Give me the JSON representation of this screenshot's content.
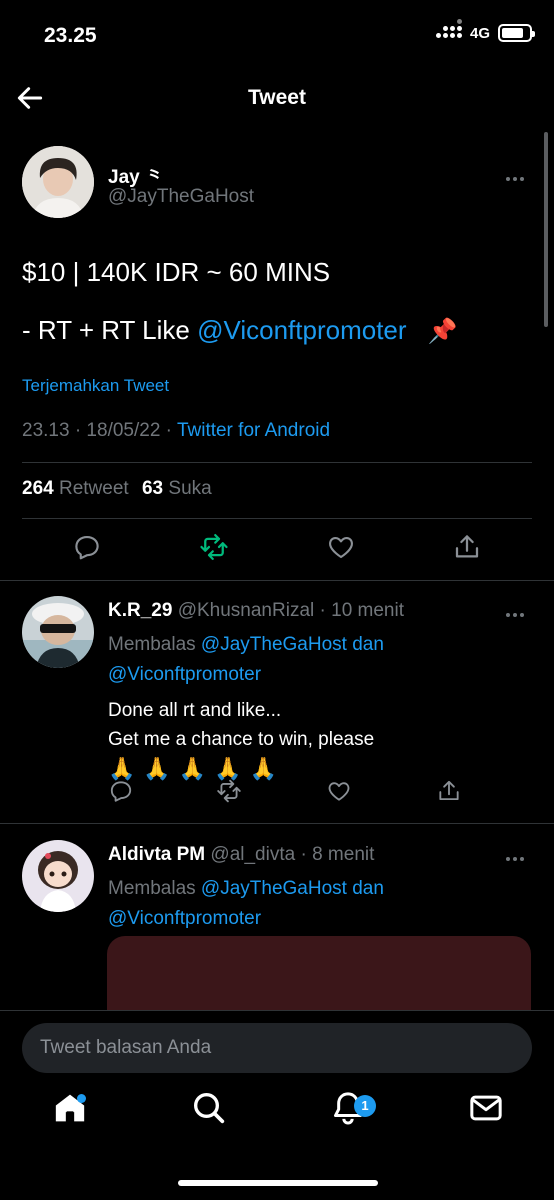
{
  "status_bar": {
    "time": "23.25",
    "network": "4G"
  },
  "header": {
    "title": "Tweet"
  },
  "tweet": {
    "author_name": "Jay ⺀",
    "author_handle": "@JayTheGaHost",
    "line1": "$10 | 140K IDR ~ 60 MINS",
    "line2_prefix": "- RT + RT Like ",
    "line2_mention": "@Viconftpromoter",
    "line2_emoji": "📌",
    "translate": "Terjemahkan Tweet",
    "timestamp": "23.13 · 18/05/22 · ",
    "source": "Twitter for Android",
    "retweets": "264",
    "retweets_label": "Retweet",
    "likes": "63",
    "likes_label": "Suka"
  },
  "replies": [
    {
      "name": "K.R_29",
      "handle": "@KhusnanRizal",
      "time": "· 10 menit",
      "replying_label": "Membalas ",
      "replying_to": "@JayTheGaHost dan",
      "replying_to2": "@Viconftpromoter",
      "line1": "Done all rt and like...",
      "line2": "Get me a chance to win, please",
      "emojis": "🙏🙏🙏🙏🙏"
    },
    {
      "name": "Aldivta PM",
      "handle": "@al_divta",
      "time": "· 8 menit",
      "replying_label": "Membalas ",
      "replying_to": "@JayTheGaHost dan",
      "replying_to2": "@Viconftpromoter"
    }
  ],
  "composer": {
    "placeholder": "Tweet balasan Anda"
  },
  "nav": {
    "notification_count": "1"
  },
  "colors": {
    "accent": "#1d9bf0",
    "retweet_active": "#00ba7c",
    "background": "#000000"
  }
}
